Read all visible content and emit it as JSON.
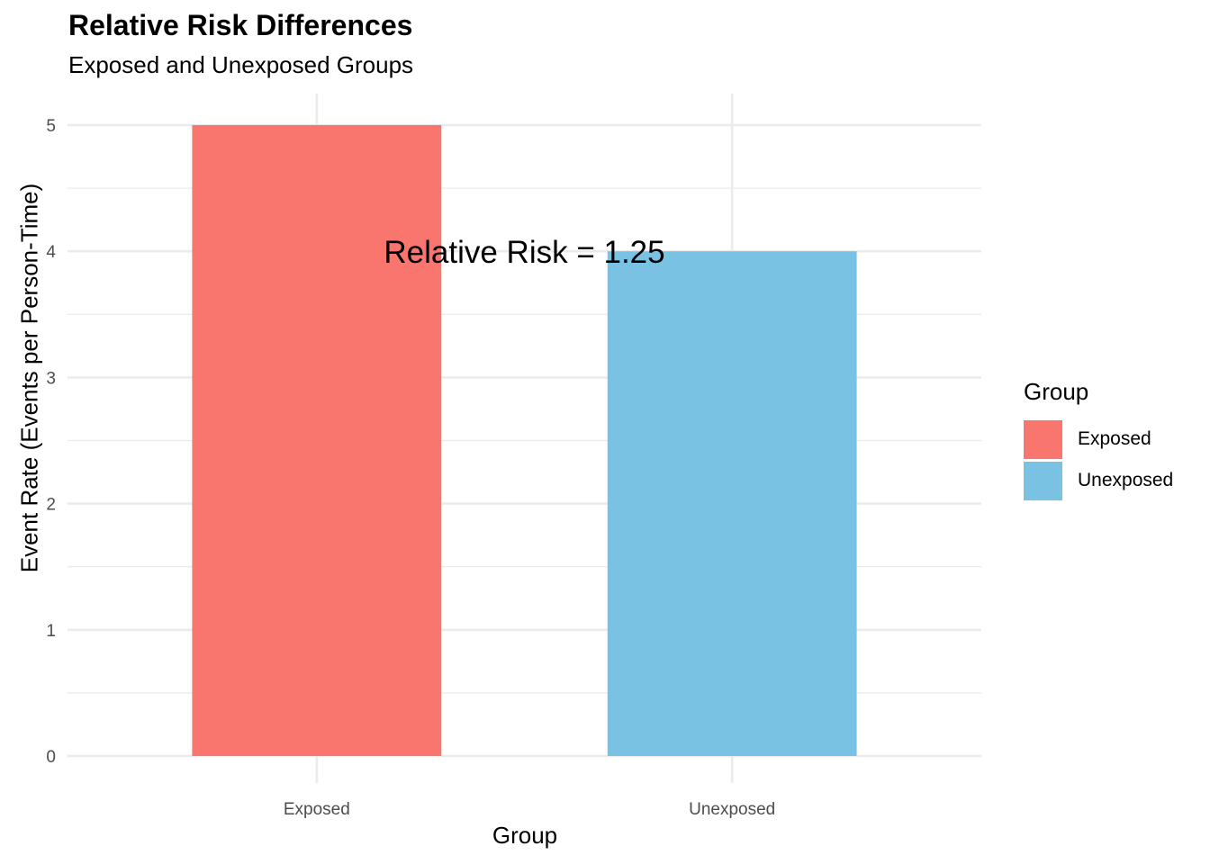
{
  "chart_data": {
    "type": "bar",
    "title": "Relative Risk Differences",
    "subtitle": "Exposed and Unexposed Groups",
    "xlabel": "Group",
    "ylabel": "Event Rate (Events per Person-Time)",
    "categories": [
      "Exposed",
      "Unexposed"
    ],
    "values": [
      5,
      4
    ],
    "colors": [
      "#F8766D",
      "#79C2E4"
    ],
    "ylim": [
      0,
      5
    ],
    "yticks": [
      0,
      1,
      2,
      3,
      4,
      5
    ],
    "ytick_labels": [
      "0",
      "1",
      "2",
      "3",
      "4",
      "5"
    ],
    "grid": true,
    "annotation": {
      "text": "Relative Risk = 1.25",
      "x": 1.5,
      "y": 4
    },
    "legend": {
      "title": "Group",
      "position": "right",
      "items": [
        {
          "label": "Exposed",
          "color": "#F8766D"
        },
        {
          "label": "Unexposed",
          "color": "#79C2E4"
        }
      ]
    }
  }
}
